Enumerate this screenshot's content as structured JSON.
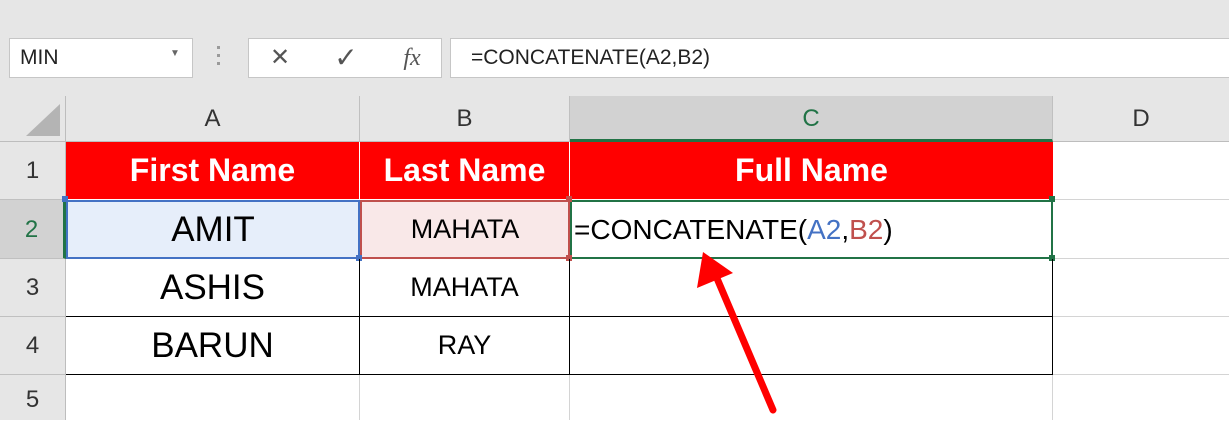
{
  "formula_bar": {
    "name_box": "MIN",
    "cancel_icon": "✕",
    "enter_icon": "✓",
    "fx_label": "fx",
    "formula": "=CONCATENATE(A2,B2)"
  },
  "columns": [
    "A",
    "B",
    "C",
    "D"
  ],
  "selected_column": "C",
  "rows": [
    "1",
    "2",
    "3",
    "4",
    "5"
  ],
  "selected_row": "2",
  "header_row": {
    "a": "First Name",
    "b": "Last Name",
    "c": "Full Name"
  },
  "data_rows": [
    {
      "a": "AMIT",
      "b": "MAHATA"
    },
    {
      "a": "ASHIS",
      "b": "MAHATA"
    },
    {
      "a": "BARUN",
      "b": "RAY"
    }
  ],
  "editing_cell": {
    "prefix": "=CONCATENATE(",
    "ref1": "A2",
    "sep": ",",
    "ref2": "B2",
    "suffix": ")"
  },
  "colors": {
    "header_fill": "#FF0000",
    "ref1_color": "#4472C4",
    "ref2_color": "#C0504D",
    "selection_green": "#217346",
    "arrow": "#FF0000"
  },
  "annotation": {
    "type": "red-arrow-icon"
  }
}
